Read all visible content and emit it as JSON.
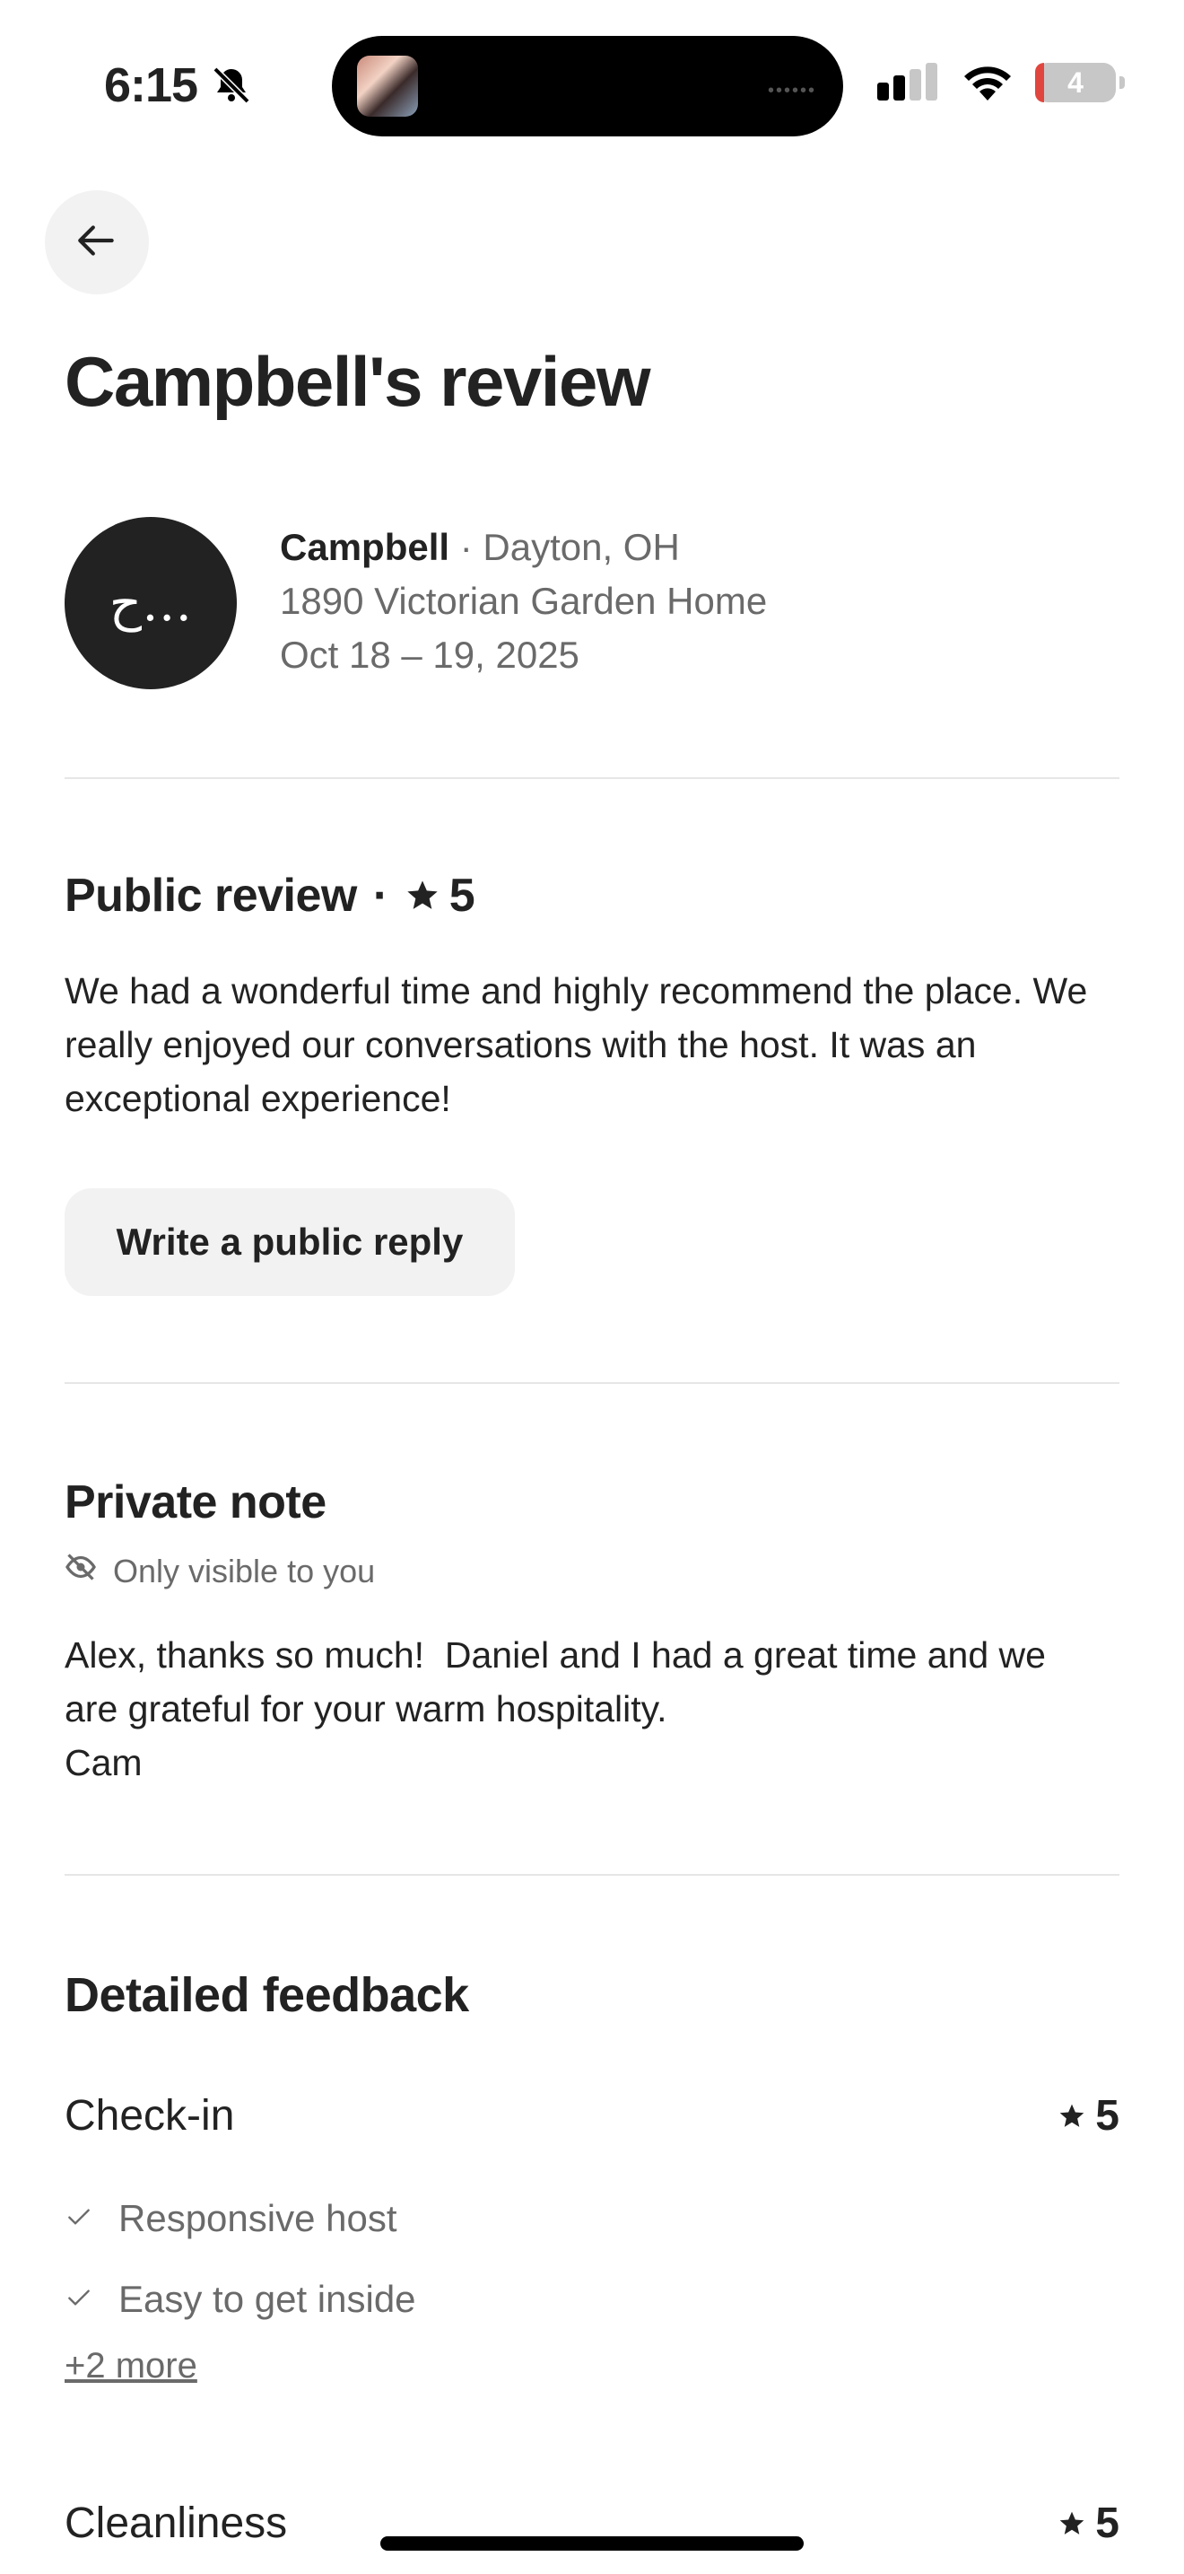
{
  "status_bar": {
    "time": "6:15",
    "icons": [
      "bell-off-icon",
      "signal-icon",
      "wifi-icon",
      "battery-icon"
    ],
    "battery_level": "4",
    "battery_low_color": "#e0463e"
  },
  "header": {
    "back_icon": "arrow-left-icon",
    "title": "Campbell's review"
  },
  "guest": {
    "avatar_text": "ح…",
    "name": "Campbell",
    "separator": " · ",
    "location": "Dayton, OH",
    "listing": "1890 Victorian Garden Home",
    "dates": "Oct 18 – 19, 2025"
  },
  "public_review": {
    "heading": "Public review",
    "dot": "·",
    "rating": "5",
    "text": "We had a wonderful time and highly recommend the place. We really enjoyed our conversations with the host. It was an exceptional experience!",
    "reply_button_label": "Write a public reply"
  },
  "private_note": {
    "heading": "Private note",
    "visibility_icon": "eye-off-icon",
    "visibility_text": "Only visible to you",
    "lines": [
      "Alex, thanks so much!  Daniel and I had a great time and we",
      "are grateful for your warm hospitality.",
      "Cam"
    ]
  },
  "detailed_feedback": {
    "heading": "Detailed feedback",
    "categories": [
      {
        "label": "Check-in",
        "rating": "5",
        "items": [
          "Responsive host",
          "Easy to get inside"
        ],
        "more_link": "+2 more"
      },
      {
        "label": "Cleanliness",
        "rating": "5"
      }
    ]
  },
  "colors": {
    "text_primary": "#222222",
    "text_secondary": "#6a6a6a",
    "button_bg": "#f2f2f2",
    "divider": "#e6e6e6"
  }
}
